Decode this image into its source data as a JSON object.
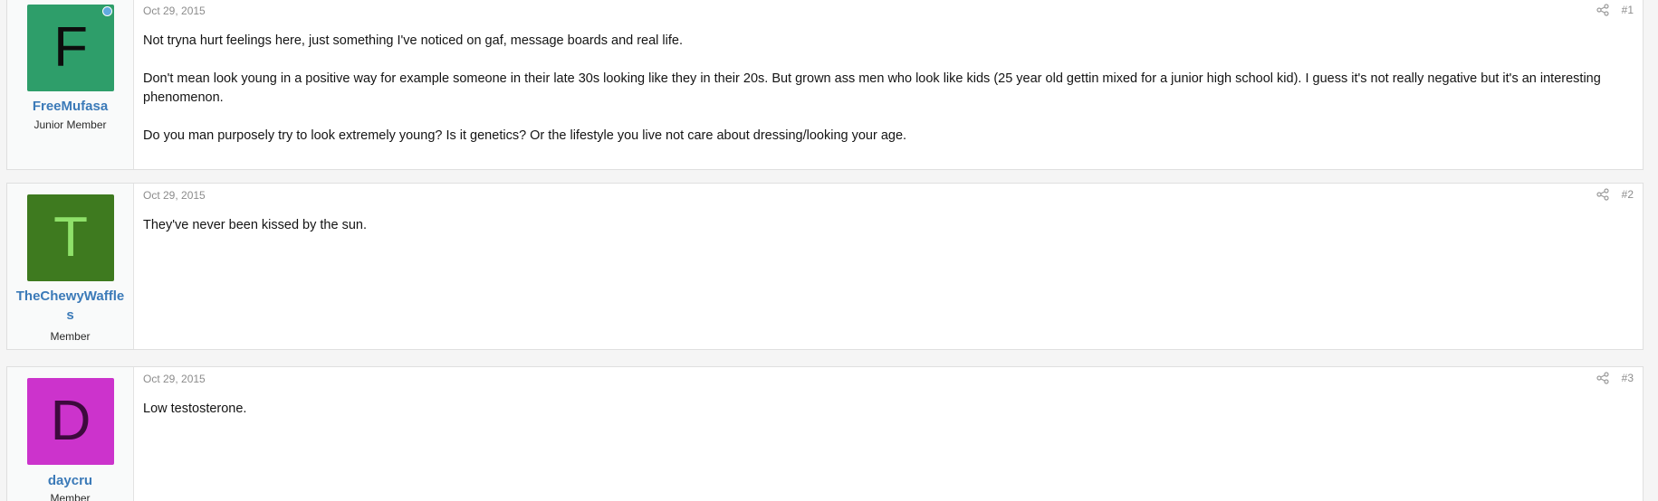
{
  "posts": [
    {
      "avatar_letter": "F",
      "avatar_bg": "#2e9e6a",
      "avatar_fg": "#0d0d0d",
      "online": true,
      "username": "FreeMufasa",
      "user_title": "Junior Member",
      "date": "Oct 29, 2015",
      "number": "#1",
      "paragraphs": [
        "Not tryna hurt feelings here, just something I've noticed on gaf, message boards and real life.",
        "Don't mean look young in a positive way for example someone in their late 30s looking like they in their 20s. But grown ass men who look like kids (25 year old gettin mixed for a junior high school kid). I guess it's not really negative but it's an interesting phenomenon.",
        "Do you man purposely try to look extremely young? Is it genetics? Or the lifestyle you live not care about dressing/looking your age."
      ]
    },
    {
      "avatar_letter": "T",
      "avatar_bg": "#3e7a1f",
      "avatar_fg": "#8fe16a",
      "online": false,
      "username": "TheChewyWaffles",
      "user_title": "Member",
      "date": "Oct 29, 2015",
      "number": "#2",
      "paragraphs": [
        "They've never been kissed by the sun."
      ]
    },
    {
      "avatar_letter": "D",
      "avatar_bg": "#cc33cc",
      "avatar_fg": "#3d0a3d",
      "online": false,
      "username": "daycru",
      "user_title": "Member",
      "date": "Oct 29, 2015",
      "number": "#3",
      "paragraphs": [
        "Low testosterone."
      ]
    }
  ],
  "icons": {
    "share": "share-icon",
    "online": "online-indicator"
  },
  "colors": {
    "username": "#3b7ab8",
    "meta": "#8c8c8c",
    "online_dot": "#61aadf"
  }
}
